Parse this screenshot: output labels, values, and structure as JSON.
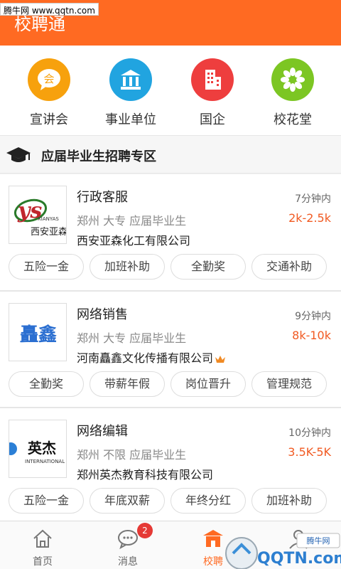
{
  "watermark_top": "腾牛网 www.qqtn.com",
  "header": {
    "title": "校聘通"
  },
  "quick": [
    {
      "label": "宣讲会",
      "icon": "speech-bubble-icon",
      "color": "#f7a10d",
      "char": "会"
    },
    {
      "label": "事业单位",
      "icon": "institution-icon",
      "color": "#21a4e0"
    },
    {
      "label": "国企",
      "icon": "building-icon",
      "color": "#ee3e3e"
    },
    {
      "label": "校花堂",
      "icon": "flower-icon",
      "color": "#7cc623"
    }
  ],
  "section": {
    "title": "应届毕业生招聘专区"
  },
  "jobs": [
    {
      "title": "行政客服",
      "time": "7分钟内",
      "meta": "郑州 大专 应届毕业生",
      "salary": "2k-2.5k",
      "company": "西安亚森化工有限公司",
      "logo_text": "西安亚森",
      "logo_sub": "XIANYAS",
      "vip": false,
      "tags": [
        "五险一金",
        "加班补助",
        "全勤奖",
        "交通补助"
      ]
    },
    {
      "title": "网络销售",
      "time": "9分钟内",
      "meta": "郑州 大专 应届毕业生",
      "salary": "8k-10k",
      "company": "河南矗鑫文化传播有限公司",
      "logo_text": "矗鑫",
      "vip": true,
      "tags": [
        "全勤奖",
        "带薪年假",
        "岗位晋升",
        "管理规范"
      ]
    },
    {
      "title": "网络编辑",
      "time": "10分钟内",
      "meta": "郑州 不限 应届毕业生",
      "salary": "3.5K-5K",
      "company": "郑州英杰教育科技有限公司",
      "logo_text": "英杰",
      "logo_sub": "INTERNATIONAL",
      "vip": false,
      "tags": [
        "五险一金",
        "年底双薪",
        "年终分红",
        "加班补助"
      ]
    }
  ],
  "tabbar": {
    "items": [
      {
        "label": "首页",
        "icon": "home-icon"
      },
      {
        "label": "消息",
        "icon": "chat-icon",
        "badge": "2"
      },
      {
        "label": "校聘",
        "icon": "school-icon",
        "active": true
      },
      {
        "label": "",
        "icon": "user-icon"
      }
    ]
  },
  "watermark_bottom": {
    "site": "QQTN.com",
    "brand": "腾牛网"
  },
  "colors": {
    "accent": "#ff6a22",
    "salary": "#f15a22"
  }
}
